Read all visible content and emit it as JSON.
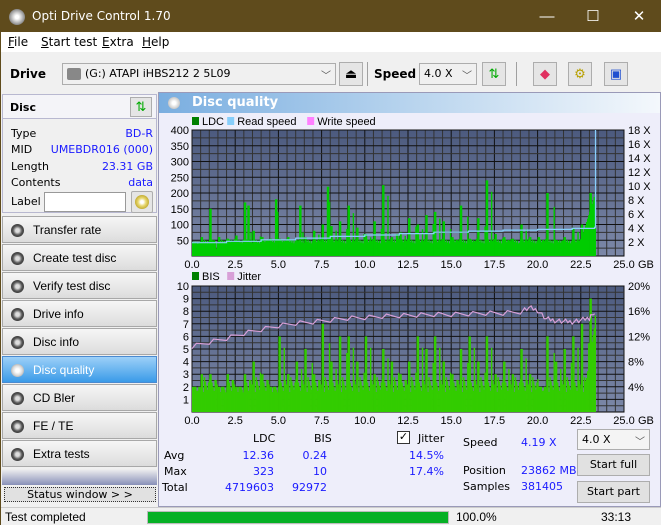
{
  "window": {
    "title": "Opti Drive Control 1.70",
    "minimize": "—",
    "maximize": "☐",
    "close": "✕"
  },
  "menu": [
    {
      "label": "File",
      "u": "F",
      "rest": "ile"
    },
    {
      "label": "Start test",
      "u": "S",
      "rest": "tart test"
    },
    {
      "label": "Extra",
      "u": "E",
      "rest": "xtra"
    },
    {
      "label": "Help",
      "u": "H",
      "rest": "elp"
    }
  ],
  "toolbar": {
    "drive_label": "Drive",
    "drive_value": "(G:)  ATAPI iHBS212  2 5L09",
    "speed_label": "Speed",
    "speed_value": "4.0 X",
    "icons": [
      "eject-icon",
      "refresh-icon",
      "eraser-icon",
      "settings-icon",
      "save-icon"
    ]
  },
  "disc": {
    "header": "Disc",
    "rows": [
      {
        "key": "Type",
        "value": "BD-R"
      },
      {
        "key": "MID",
        "value": "UMEBDR016 (000)"
      },
      {
        "key": "Length",
        "value": "23.31 GB"
      },
      {
        "key": "Contents",
        "value": "data"
      }
    ],
    "label_key": "Label",
    "label_value": ""
  },
  "nav": [
    {
      "label": "Transfer rate",
      "active": false
    },
    {
      "label": "Create test disc",
      "active": false
    },
    {
      "label": "Verify test disc",
      "active": false
    },
    {
      "label": "Drive info",
      "active": false
    },
    {
      "label": "Disc info",
      "active": false
    },
    {
      "label": "Disc quality",
      "active": true
    },
    {
      "label": "CD Bler",
      "active": false
    },
    {
      "label": "FE / TE",
      "active": false
    },
    {
      "label": "Extra tests",
      "active": false
    }
  ],
  "status_window_label": "Status window > >",
  "main": {
    "title": "Disc quality"
  },
  "chart_data": [
    {
      "type": "bar",
      "title": "LDC / Read speed",
      "legend": [
        {
          "name": "LDC",
          "color": "#008000"
        },
        {
          "name": "Read speed",
          "color": "#87cefa"
        },
        {
          "name": "Write speed",
          "color": "#ff80ff"
        }
      ],
      "xlabel": "GB",
      "x_ticks": [
        "0.0",
        "2.5",
        "5.0",
        "7.5",
        "10.0",
        "12.5",
        "15.0",
        "17.5",
        "20.0",
        "22.5",
        "25.0"
      ],
      "xlim": [
        0,
        25
      ],
      "ylim": [
        0,
        400
      ],
      "y_ticks": [
        "50",
        "100",
        "150",
        "200",
        "250",
        "300",
        "350",
        "400"
      ],
      "y2lim": [
        0,
        18
      ],
      "y2_ticks": [
        "2 X",
        "4 X",
        "6 X",
        "8 X",
        "10 X",
        "12 X",
        "14 X",
        "16 X",
        "18 X"
      ],
      "series": [
        {
          "name": "LDC",
          "color": "#00cc00",
          "x": [
            0.0,
            0.5,
            1.0,
            1.2,
            1.5,
            2.0,
            2.5,
            3.0,
            3.2,
            3.5,
            4.0,
            4.5,
            4.8,
            5.0,
            5.5,
            6.0,
            6.2,
            6.5,
            7.0,
            7.5,
            7.8,
            8.0,
            8.5,
            9.0,
            9.5,
            10.0,
            10.5,
            11.0,
            11.5,
            11.8,
            12.0,
            12.5,
            13.0,
            13.5,
            14.0,
            14.5,
            15.0,
            15.5,
            16.0,
            16.5,
            17.0,
            17.5,
            18.0,
            18.5,
            19.0,
            19.5,
            20.0,
            20.5,
            21.0,
            21.5,
            22.0,
            22.5,
            23.0,
            23.3
          ],
          "values": [
            45,
            60,
            150,
            50,
            60,
            55,
            65,
            170,
            160,
            80,
            60,
            55,
            180,
            55,
            60,
            50,
            160,
            60,
            80,
            100,
            220,
            95,
            110,
            160,
            90,
            70,
            110,
            225,
            60,
            70,
            75,
            120,
            100,
            130,
            140,
            110,
            60,
            160,
            55,
            120,
            240,
            70,
            60,
            55,
            100,
            60,
            60,
            200,
            50,
            60,
            90,
            100,
            200,
            330
          ]
        },
        {
          "name": "Read speed",
          "color": "#87cefa",
          "unit": "X",
          "x": [
            0,
            2,
            4,
            6,
            8,
            10,
            12,
            14,
            16,
            18,
            20,
            22,
            23.3,
            23.35
          ],
          "values": [
            1.9,
            2.1,
            2.3,
            2.55,
            2.8,
            3.0,
            3.2,
            3.4,
            3.55,
            3.7,
            3.8,
            3.95,
            4.1,
            18
          ]
        }
      ]
    },
    {
      "type": "bar",
      "title": "BIS / Jitter",
      "legend": [
        {
          "name": "BIS",
          "color": "#008000"
        },
        {
          "name": "Jitter",
          "color": "#d8a0d8"
        }
      ],
      "xlabel": "GB",
      "x_ticks": [
        "0.0",
        "2.5",
        "5.0",
        "7.5",
        "10.0",
        "12.5",
        "15.0",
        "17.5",
        "20.0",
        "22.5",
        "25.0"
      ],
      "xlim": [
        0,
        25
      ],
      "ylim": [
        0,
        10
      ],
      "y_ticks": [
        "1",
        "2",
        "3",
        "4",
        "5",
        "6",
        "7",
        "8",
        "9",
        "10"
      ],
      "y2lim": [
        0,
        20
      ],
      "y2_ticks": [
        "4%",
        "8%",
        "12%",
        "16%",
        "20%"
      ],
      "series": [
        {
          "name": "BIS",
          "color": "#33cc00",
          "x": [
            0.0,
            0.5,
            1.0,
            1.5,
            2.0,
            2.5,
            3.0,
            3.5,
            4.0,
            4.5,
            5.0,
            5.5,
            6.0,
            6.5,
            7.0,
            7.5,
            8.0,
            8.5,
            9.0,
            9.5,
            10.0,
            10.5,
            11.0,
            11.5,
            12.0,
            12.5,
            13.0,
            13.5,
            14.0,
            14.5,
            15.0,
            15.5,
            16.0,
            16.5,
            17.0,
            17.5,
            18.0,
            18.5,
            19.0,
            19.5,
            20.0,
            20.5,
            21.0,
            21.5,
            22.0,
            22.5,
            23.0,
            23.3
          ],
          "values": [
            2,
            3,
            3,
            2,
            3,
            2,
            3,
            4,
            3,
            2,
            6,
            3,
            4,
            5,
            3,
            7,
            4,
            6,
            6,
            4,
            6,
            3,
            5,
            4,
            3,
            4,
            6,
            5,
            6,
            4,
            3,
            5,
            6,
            4,
            6,
            3,
            4,
            3,
            5,
            3,
            2,
            6,
            4,
            5,
            6,
            7,
            9,
            10
          ]
        },
        {
          "name": "Jitter",
          "color": "#d8a0d8",
          "unit": "%",
          "x": [
            0,
            1,
            2,
            3,
            4,
            5,
            6,
            7,
            8,
            9,
            10,
            11,
            12,
            13,
            14,
            15,
            16,
            17,
            18,
            19,
            19.5,
            20,
            20.5,
            21,
            21.5,
            22,
            22.5,
            23,
            23.3
          ],
          "values": [
            10.5,
            11.2,
            11.8,
            12.6,
            13.2,
            13.8,
            14.2,
            14.4,
            14.7,
            15.0,
            15.1,
            15.3,
            15.4,
            15.5,
            15.6,
            15.6,
            15.7,
            15.8,
            15.8,
            16.0,
            16.6,
            16.2,
            14.8,
            14.6,
            14.4,
            14.4,
            14.6,
            15.0,
            15.6
          ]
        }
      ]
    }
  ],
  "stats": {
    "col_ldc": "LDC",
    "col_bis": "BIS",
    "jitter_label": "Jitter",
    "jitter_checked": true,
    "avg_label": "Avg",
    "max_label": "Max",
    "total_label": "Total",
    "ldc_avg": "12.36",
    "ldc_max": "323",
    "ldc_total": "4719603",
    "bis_avg": "0.24",
    "bis_max": "10",
    "bis_total": "92972",
    "jit_avg": "14.5%",
    "jit_max": "17.4%",
    "speed_label": "Speed",
    "speed_value": "4.19 X",
    "position_label": "Position",
    "position_value": "23862 MB",
    "samples_label": "Samples",
    "samples_value": "381405",
    "speed_select": "4.0 X",
    "start_full": "Start full",
    "start_part": "Start part"
  },
  "statusbar": {
    "text": "Test completed",
    "progress": 100.0,
    "progress_text": "100.0%",
    "time": "33:13"
  }
}
